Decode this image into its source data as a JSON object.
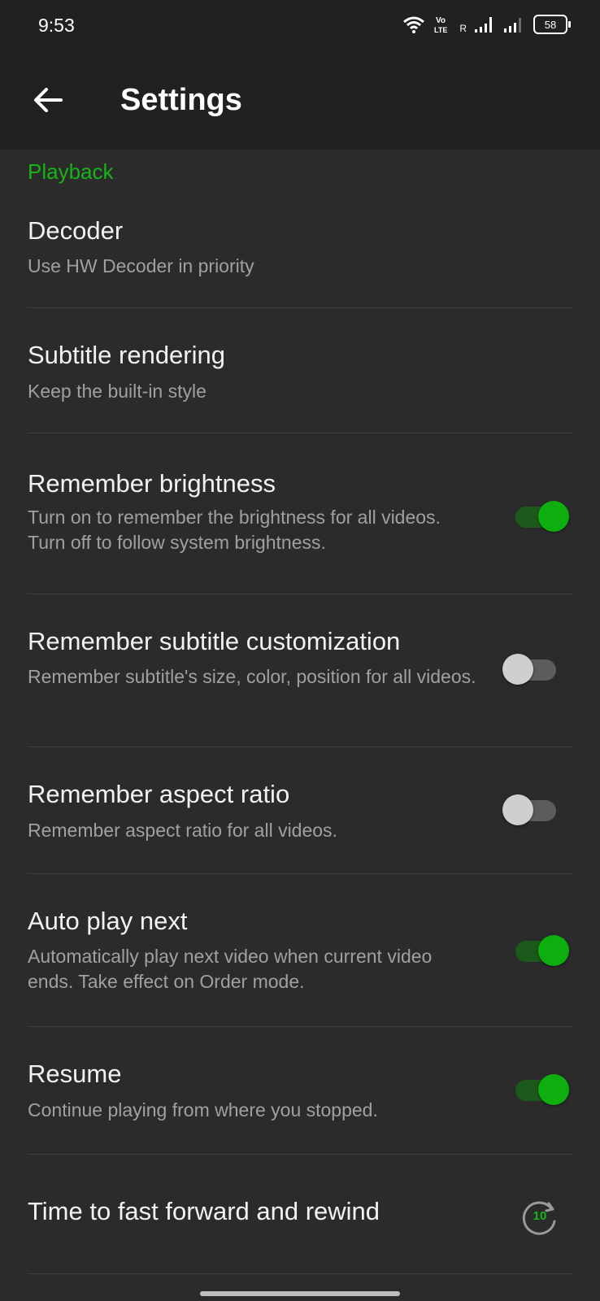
{
  "status_bar": {
    "time": "9:53",
    "battery": "58",
    "network_label": "R"
  },
  "header": {
    "title": "Settings",
    "back_icon": "arrow-left-icon"
  },
  "section": {
    "title": "Playback"
  },
  "items": [
    {
      "title": "Decoder",
      "subtitle": "Use HW Decoder in priority"
    },
    {
      "title": "Subtitle rendering",
      "subtitle": "Keep the built-in style"
    },
    {
      "title": "Remember brightness",
      "subtitle": "Turn on to remember the brightness for all videos. Turn off to follow system brightness.",
      "toggle": true
    },
    {
      "title": "Remember subtitle customization",
      "subtitle": "Remember subtitle's size, color, position for all videos.",
      "toggle": false
    },
    {
      "title": "Remember aspect ratio",
      "subtitle": "Remember aspect ratio for all videos.",
      "toggle": false
    },
    {
      "title": "Auto play next",
      "subtitle": "Automatically play next video when current video ends. Take effect on Order mode.",
      "toggle": true
    },
    {
      "title": "Resume",
      "subtitle": "Continue playing from where you stopped.",
      "toggle": true
    },
    {
      "title": "Time to fast forward and rewind",
      "value": "10",
      "icon": "fast-forward-10-icon"
    }
  ],
  "colors": {
    "accent": "#16b416",
    "background": "#2b2b2b",
    "appbar": "#212121"
  }
}
